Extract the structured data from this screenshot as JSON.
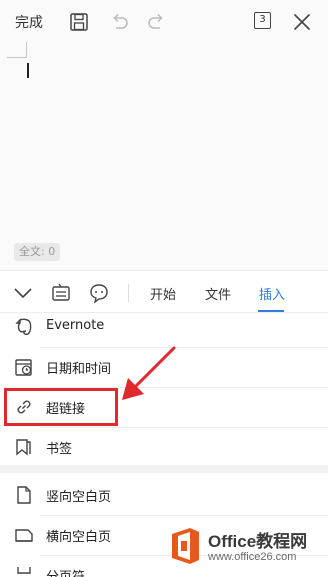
{
  "toolbar": {
    "done_label": "完成",
    "save_icon": "save-icon",
    "undo_icon": "undo-icon",
    "redo_icon": "redo-icon",
    "page_count": "3",
    "close_icon": "close-icon"
  },
  "document": {
    "word_count": "全文: 0"
  },
  "tabbar": {
    "collapse_icon": "chevron-down-icon",
    "keyboard_icon": "keyboard-icon",
    "emoji_icon": "emoji-icon",
    "tabs": [
      {
        "label": "开始",
        "active": false
      },
      {
        "label": "文件",
        "active": false
      },
      {
        "label": "插入",
        "active": true
      }
    ],
    "accent_color": "#2f7fe0"
  },
  "menu": {
    "items": [
      {
        "label": "Evernote",
        "icon": "evernote-icon"
      },
      {
        "label": "日期和时间",
        "icon": "calendar-clock-icon"
      },
      {
        "label": "超链接",
        "icon": "link-icon"
      },
      {
        "label": "书签",
        "icon": "bookmark-icon"
      },
      {
        "label": "竖向空白页",
        "icon": "portrait-page-icon"
      },
      {
        "label": "横向空白页",
        "icon": "landscape-page-icon"
      },
      {
        "label": "分页符",
        "icon": "page-break-icon"
      }
    ]
  },
  "annotation": {
    "highlight_color": "#e0282d"
  },
  "watermark": {
    "title": "Office教程网",
    "url": "www.office26.com",
    "logo_color": "#e8581c"
  }
}
